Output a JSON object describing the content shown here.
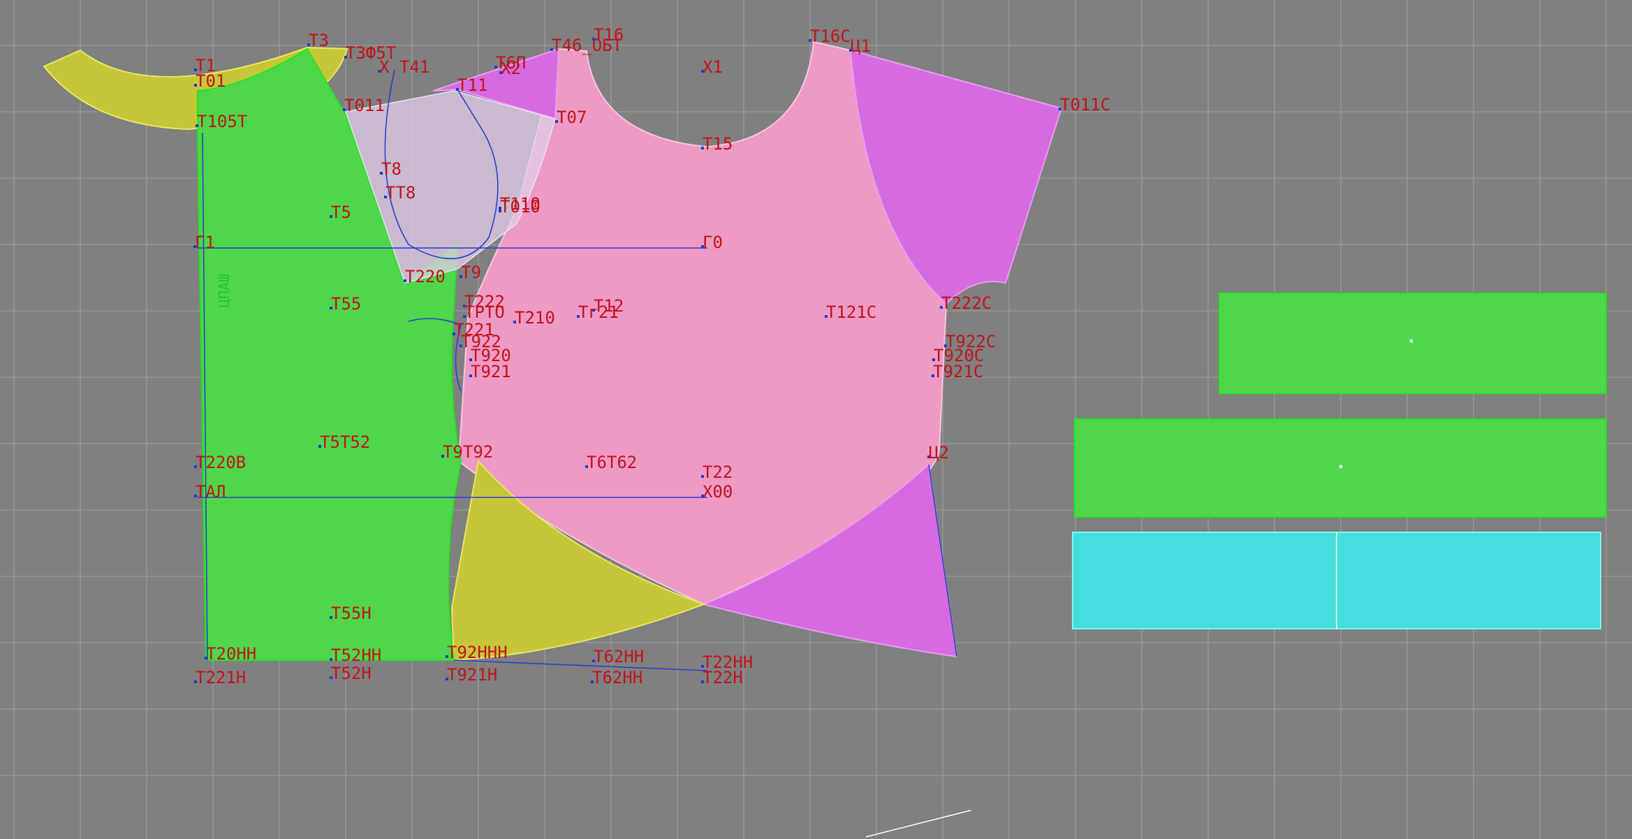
{
  "workspace": {
    "grid_on": true
  },
  "colors": {
    "background": "#808080",
    "grid": "#9a9a9a",
    "front_panel": "#4fd64a",
    "front_panel_stroke": "#1ee91e",
    "back_panel": "#ee9ac4",
    "sleeve": "#d66be0",
    "facing": "#c7c63a",
    "cuff_piece": "#44dede",
    "label_text": "#c0141c",
    "guide_line": "#2a3fcf",
    "point_marker": "#1a3fd6"
  },
  "pieces": [
    {
      "name": "neck-facing-piece",
      "fill": "facing"
    },
    {
      "name": "front-panel-piece",
      "fill": "front_panel"
    },
    {
      "name": "back-panel-piece",
      "fill": "back_panel"
    },
    {
      "name": "sleeve-piece",
      "fill": "sleeve"
    },
    {
      "name": "hem-facing-piece",
      "fill": "facing"
    },
    {
      "name": "band-piece-1",
      "fill": "front_panel"
    },
    {
      "name": "band-piece-2",
      "fill": "front_panel"
    },
    {
      "name": "cuff-piece",
      "fill": "cuff_piece"
    }
  ],
  "vertical_text": "ЦПАШ",
  "point_labels": [
    {
      "id": "t1",
      "text": "Т1"
    },
    {
      "id": "t01",
      "text": "Т01"
    },
    {
      "id": "t3",
      "text": "Т3"
    },
    {
      "id": "t3o5t",
      "text": "Т3Ф5Т"
    },
    {
      "id": "x-t41",
      "text": "Х Т41"
    },
    {
      "id": "t6p",
      "text": "Т6П"
    },
    {
      "id": "x2",
      "text": "Х2"
    },
    {
      "id": "t46_obt",
      "text": "Т46_ОБТ"
    },
    {
      "id": "t16",
      "text": "Т16"
    },
    {
      "id": "x1",
      "text": "Х1"
    },
    {
      "id": "t16c",
      "text": "Т16С"
    },
    {
      "id": "ts1",
      "text": "Ц1"
    },
    {
      "id": "t011c",
      "text": "Т011С"
    },
    {
      "id": "t11",
      "text": "Т11"
    },
    {
      "id": "t105t",
      "text": "Т105Т"
    },
    {
      "id": "t011",
      "text": "Т011"
    },
    {
      "id": "t07",
      "text": "Т07"
    },
    {
      "id": "t15",
      "text": "Т15"
    },
    {
      "id": "t8a",
      "text": "Т8"
    },
    {
      "id": "t8b",
      "text": "ТТ8"
    },
    {
      "id": "t5",
      "text": "Т5"
    },
    {
      "id": "t10",
      "text": "Т110"
    },
    {
      "id": "t010",
      "text": "Т010"
    },
    {
      "id": "g1",
      "text": "Г1"
    },
    {
      "id": "g0",
      "text": "Г0"
    },
    {
      "id": "t220",
      "text": "Т220"
    },
    {
      "id": "t9",
      "text": "Т9"
    },
    {
      "id": "t55",
      "text": "Т55"
    },
    {
      "id": "t222",
      "text": "Т222"
    },
    {
      "id": "tpto",
      "text": "ТРТО"
    },
    {
      "id": "t210",
      "text": "Т210"
    },
    {
      "id": "t12",
      "text": "Т12"
    },
    {
      "id": "t121",
      "text": "Тг21"
    },
    {
      "id": "t221",
      "text": "Т221"
    },
    {
      "id": "t922",
      "text": "Т922"
    },
    {
      "id": "t920",
      "text": "Т920"
    },
    {
      "id": "t921",
      "text": "Т921"
    },
    {
      "id": "t121c",
      "text": "Т121С"
    },
    {
      "id": "t222c",
      "text": "Т222С"
    },
    {
      "id": "t922c",
      "text": "Т922С"
    },
    {
      "id": "t920c",
      "text": "Т920С"
    },
    {
      "id": "t921c",
      "text": "Т921С"
    },
    {
      "id": "t220b",
      "text": "Т220В"
    },
    {
      "id": "t5152",
      "text": "Т5Т52"
    },
    {
      "id": "t9192",
      "text": "Т9Т92"
    },
    {
      "id": "t6162",
      "text": "Т6Т62"
    },
    {
      "id": "t22",
      "text": "Т22"
    },
    {
      "id": "ts2",
      "text": "Ц2"
    },
    {
      "id": "tal",
      "text": "ТАЛ"
    },
    {
      "id": "x00",
      "text": "Х00"
    },
    {
      "id": "t55h",
      "text": "Т55Н"
    },
    {
      "id": "t20hh",
      "text": "Т20НН"
    },
    {
      "id": "t52hh",
      "text": "Т52НН"
    },
    {
      "id": "t92hhh",
      "text": "Т92ННН"
    },
    {
      "id": "t62hh",
      "text": "Т62НН"
    },
    {
      "id": "t22hh",
      "text": "Т22НН"
    },
    {
      "id": "t221h",
      "text": "Т221Н"
    },
    {
      "id": "t52h",
      "text": "Т52Н"
    },
    {
      "id": "t921h",
      "text": "Т921Н"
    },
    {
      "id": "t6hhh",
      "text": "Т62НН"
    },
    {
      "id": "t22h",
      "text": "Т22Н"
    }
  ]
}
